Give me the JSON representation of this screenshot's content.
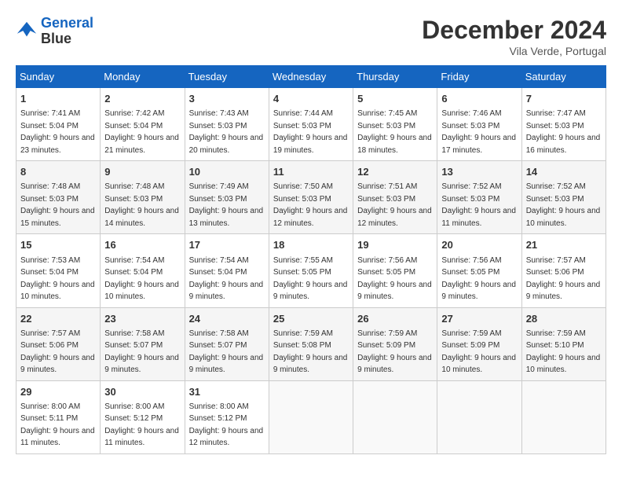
{
  "header": {
    "logo_line1": "General",
    "logo_line2": "Blue",
    "month_title": "December 2024",
    "location": "Vila Verde, Portugal"
  },
  "weekdays": [
    "Sunday",
    "Monday",
    "Tuesday",
    "Wednesday",
    "Thursday",
    "Friday",
    "Saturday"
  ],
  "weeks": [
    [
      {
        "day": "1",
        "sunrise": "7:41 AM",
        "sunset": "5:04 PM",
        "daylight": "9 hours and 23 minutes."
      },
      {
        "day": "2",
        "sunrise": "7:42 AM",
        "sunset": "5:04 PM",
        "daylight": "9 hours and 21 minutes."
      },
      {
        "day": "3",
        "sunrise": "7:43 AM",
        "sunset": "5:03 PM",
        "daylight": "9 hours and 20 minutes."
      },
      {
        "day": "4",
        "sunrise": "7:44 AM",
        "sunset": "5:03 PM",
        "daylight": "9 hours and 19 minutes."
      },
      {
        "day": "5",
        "sunrise": "7:45 AM",
        "sunset": "5:03 PM",
        "daylight": "9 hours and 18 minutes."
      },
      {
        "day": "6",
        "sunrise": "7:46 AM",
        "sunset": "5:03 PM",
        "daylight": "9 hours and 17 minutes."
      },
      {
        "day": "7",
        "sunrise": "7:47 AM",
        "sunset": "5:03 PM",
        "daylight": "9 hours and 16 minutes."
      }
    ],
    [
      {
        "day": "8",
        "sunrise": "7:48 AM",
        "sunset": "5:03 PM",
        "daylight": "9 hours and 15 minutes."
      },
      {
        "day": "9",
        "sunrise": "7:48 AM",
        "sunset": "5:03 PM",
        "daylight": "9 hours and 14 minutes."
      },
      {
        "day": "10",
        "sunrise": "7:49 AM",
        "sunset": "5:03 PM",
        "daylight": "9 hours and 13 minutes."
      },
      {
        "day": "11",
        "sunrise": "7:50 AM",
        "sunset": "5:03 PM",
        "daylight": "9 hours and 12 minutes."
      },
      {
        "day": "12",
        "sunrise": "7:51 AM",
        "sunset": "5:03 PM",
        "daylight": "9 hours and 12 minutes."
      },
      {
        "day": "13",
        "sunrise": "7:52 AM",
        "sunset": "5:03 PM",
        "daylight": "9 hours and 11 minutes."
      },
      {
        "day": "14",
        "sunrise": "7:52 AM",
        "sunset": "5:03 PM",
        "daylight": "9 hours and 10 minutes."
      }
    ],
    [
      {
        "day": "15",
        "sunrise": "7:53 AM",
        "sunset": "5:04 PM",
        "daylight": "9 hours and 10 minutes."
      },
      {
        "day": "16",
        "sunrise": "7:54 AM",
        "sunset": "5:04 PM",
        "daylight": "9 hours and 10 minutes."
      },
      {
        "day": "17",
        "sunrise": "7:54 AM",
        "sunset": "5:04 PM",
        "daylight": "9 hours and 9 minutes."
      },
      {
        "day": "18",
        "sunrise": "7:55 AM",
        "sunset": "5:05 PM",
        "daylight": "9 hours and 9 minutes."
      },
      {
        "day": "19",
        "sunrise": "7:56 AM",
        "sunset": "5:05 PM",
        "daylight": "9 hours and 9 minutes."
      },
      {
        "day": "20",
        "sunrise": "7:56 AM",
        "sunset": "5:05 PM",
        "daylight": "9 hours and 9 minutes."
      },
      {
        "day": "21",
        "sunrise": "7:57 AM",
        "sunset": "5:06 PM",
        "daylight": "9 hours and 9 minutes."
      }
    ],
    [
      {
        "day": "22",
        "sunrise": "7:57 AM",
        "sunset": "5:06 PM",
        "daylight": "9 hours and 9 minutes."
      },
      {
        "day": "23",
        "sunrise": "7:58 AM",
        "sunset": "5:07 PM",
        "daylight": "9 hours and 9 minutes."
      },
      {
        "day": "24",
        "sunrise": "7:58 AM",
        "sunset": "5:07 PM",
        "daylight": "9 hours and 9 minutes."
      },
      {
        "day": "25",
        "sunrise": "7:59 AM",
        "sunset": "5:08 PM",
        "daylight": "9 hours and 9 minutes."
      },
      {
        "day": "26",
        "sunrise": "7:59 AM",
        "sunset": "5:09 PM",
        "daylight": "9 hours and 9 minutes."
      },
      {
        "day": "27",
        "sunrise": "7:59 AM",
        "sunset": "5:09 PM",
        "daylight": "9 hours and 10 minutes."
      },
      {
        "day": "28",
        "sunrise": "7:59 AM",
        "sunset": "5:10 PM",
        "daylight": "9 hours and 10 minutes."
      }
    ],
    [
      {
        "day": "29",
        "sunrise": "8:00 AM",
        "sunset": "5:11 PM",
        "daylight": "9 hours and 11 minutes."
      },
      {
        "day": "30",
        "sunrise": "8:00 AM",
        "sunset": "5:12 PM",
        "daylight": "9 hours and 11 minutes."
      },
      {
        "day": "31",
        "sunrise": "8:00 AM",
        "sunset": "5:12 PM",
        "daylight": "9 hours and 12 minutes."
      },
      null,
      null,
      null,
      null
    ]
  ]
}
